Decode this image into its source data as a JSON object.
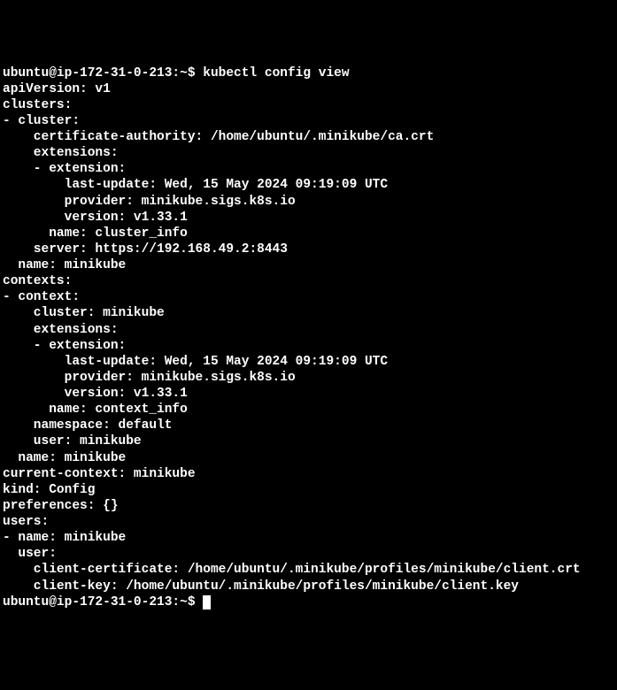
{
  "terminal": {
    "prompt1": "ubuntu@ip-172-31-0-213:~$ ",
    "command1": "kubectl config view",
    "lines": [
      "apiVersion: v1",
      "clusters:",
      "- cluster:",
      "    certificate-authority: /home/ubuntu/.minikube/ca.crt",
      "    extensions:",
      "    - extension:",
      "        last-update: Wed, 15 May 2024 09:19:09 UTC",
      "        provider: minikube.sigs.k8s.io",
      "        version: v1.33.1",
      "      name: cluster_info",
      "    server: https://192.168.49.2:8443",
      "  name: minikube",
      "contexts:",
      "- context:",
      "    cluster: minikube",
      "    extensions:",
      "    - extension:",
      "        last-update: Wed, 15 May 2024 09:19:09 UTC",
      "        provider: minikube.sigs.k8s.io",
      "        version: v1.33.1",
      "      name: context_info",
      "    namespace: default",
      "    user: minikube",
      "  name: minikube",
      "current-context: minikube",
      "kind: Config",
      "preferences: {}",
      "users:",
      "- name: minikube",
      "  user:",
      "    client-certificate: /home/ubuntu/.minikube/profiles/minikube/client.crt",
      "    client-key: /home/ubuntu/.minikube/profiles/minikube/client.key"
    ],
    "prompt2": "ubuntu@ip-172-31-0-213:~$ "
  }
}
